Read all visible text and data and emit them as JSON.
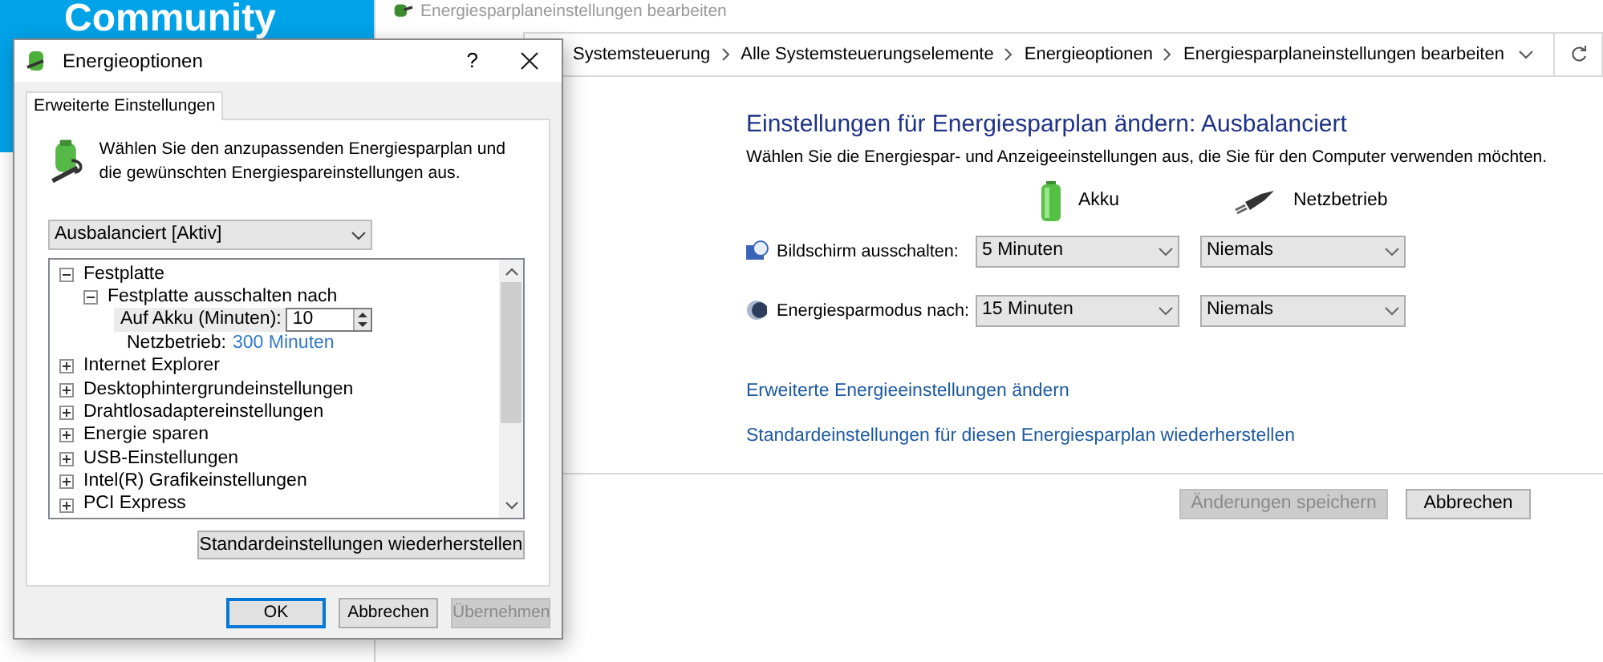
{
  "background_page": {
    "header_title": "Community"
  },
  "window": {
    "title": "Energiesparplaneinstellungen bearbeiten",
    "breadcrumbs": [
      "Systemsteuerung",
      "Alle Systemsteuerungselemente",
      "Energieoptionen",
      "Energiesparplaneinstellungen bearbeiten"
    ],
    "heading": "Einstellungen für Energiesparplan ändern: Ausbalanciert",
    "description": "Wählen Sie die Energiespar- und Anzeigeeinstellungen aus, die Sie für den Computer verwenden möchten.",
    "columns": [
      {
        "kind": "battery",
        "label": "Akku"
      },
      {
        "kind": "plug",
        "label": "Netzbetrieb"
      }
    ],
    "settings": [
      {
        "kind": "display",
        "label": "Bildschirm ausschalten:",
        "battery_value": "5 Minuten",
        "plugged_value": "Niemals"
      },
      {
        "kind": "sleep",
        "label": "Energiesparmodus nach:",
        "battery_value": "15 Minuten",
        "plugged_value": "Niemals"
      }
    ],
    "links": [
      "Erweiterte Energieeinstellungen ändern",
      "Standardeinstellungen für diesen Energiesparplan wiederherstellen"
    ],
    "buttons": [
      {
        "label": "Änderungen speichern",
        "disabled": true
      },
      {
        "label": "Abbrechen",
        "disabled": false
      }
    ]
  },
  "dialog": {
    "title": "Energieoptionen",
    "help": "?",
    "tabs": [
      {
        "label": "Erweiterte Einstellungen",
        "selected": true
      }
    ],
    "description": "Wählen Sie den anzupassenden Energiesparplan und die gewünschten Energiespareinstellungen aus.",
    "plan_select": {
      "value": "Ausbalanciert [Aktiv]"
    },
    "tree": [
      {
        "label": "Festplatte",
        "expanded": true,
        "children": [
          {
            "label": "Festplatte ausschalten nach",
            "expanded": true,
            "children": [
              {
                "kind": "spin",
                "label": "Auf Akku (Minuten):",
                "value": "10"
              },
              {
                "kind": "link",
                "label": "Netzbetrieb:",
                "value": "300 Minuten"
              }
            ]
          }
        ]
      },
      {
        "label": "Internet Explorer",
        "expanded": false
      },
      {
        "label": "Desktophintergrundeinstellungen",
        "expanded": false
      },
      {
        "label": "Drahtlosadaptereinstellungen",
        "expanded": false
      },
      {
        "label": "Energie sparen",
        "expanded": false
      },
      {
        "label": "USB-Einstellungen",
        "expanded": false
      },
      {
        "label": "Intel(R) Grafikeinstellungen",
        "expanded": false
      },
      {
        "label": "PCI Express",
        "expanded": false
      }
    ],
    "restore_button": "Standardeinstellungen wiederherstellen",
    "buttons": [
      {
        "label": "OK",
        "default": true,
        "disabled": false
      },
      {
        "label": "Abbrechen",
        "default": false,
        "disabled": false
      },
      {
        "label": "Übernehmen",
        "default": false,
        "disabled": true
      }
    ]
  }
}
